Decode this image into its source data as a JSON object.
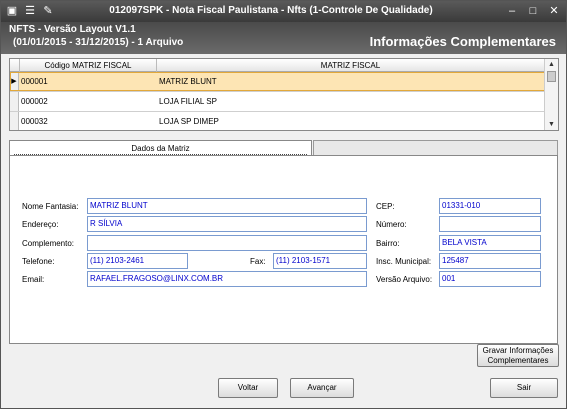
{
  "titlebar": {
    "icon1": "▣",
    "icon2": "☰",
    "icon3": "✎",
    "title": "012097SPK - Nota Fiscal Paulistana - Nfts (1-Controle De Qualidade)",
    "minimize": "–",
    "maximize": "□",
    "close": "✕"
  },
  "header": {
    "line1": "NFTS - Versão Layout V1.1",
    "line2": "(01/01/2015 - 31/12/2015) - 1 Arquivo",
    "section_title": "Informações Complementares"
  },
  "grid": {
    "columns": [
      "Código MATRIZ FISCAL",
      "MATRIZ FISCAL"
    ],
    "row_indicator": "▶",
    "rows": [
      {
        "codigo": "000001",
        "nome": "MATRIZ BLUNT"
      },
      {
        "codigo": "000002",
        "nome": "LOJA FILIAL SP"
      },
      {
        "codigo": "000032",
        "nome": "LOJA SP DIMEP"
      }
    ],
    "scroll_up": "▲",
    "scroll_down": "▼"
  },
  "tabs": {
    "active": "Dados da Matriz"
  },
  "form": {
    "nome_fantasia": {
      "label": "Nome Fantasia:",
      "value": "MATRIZ BLUNT"
    },
    "endereco": {
      "label": "Endereço:",
      "value": "R SÍLVIA"
    },
    "complemento": {
      "label": "Complemento:",
      "value": ""
    },
    "telefone": {
      "label": "Telefone:",
      "value": "(11) 2103-2461"
    },
    "fax": {
      "label": "Fax:",
      "value": "(11) 2103-1571"
    },
    "email": {
      "label": "Email:",
      "value": "RAFAEL.FRAGOSO@LINX.COM.BR"
    },
    "cep": {
      "label": "CEP:",
      "value": "01331-010"
    },
    "numero": {
      "label": "Número:",
      "value": ""
    },
    "bairro": {
      "label": "Bairro:",
      "value": "BELA VISTA"
    },
    "insc_municipal": {
      "label": "Insc. Municipal:",
      "value": "125487"
    },
    "versao_arquivo": {
      "label": "Versão Arquivo:",
      "value": "001"
    }
  },
  "buttons": {
    "gravar_line1": "Gravar Informações",
    "gravar_line2": "Complementares",
    "voltar": "Voltar",
    "avancar": "Avançar",
    "sair": "Sair"
  }
}
